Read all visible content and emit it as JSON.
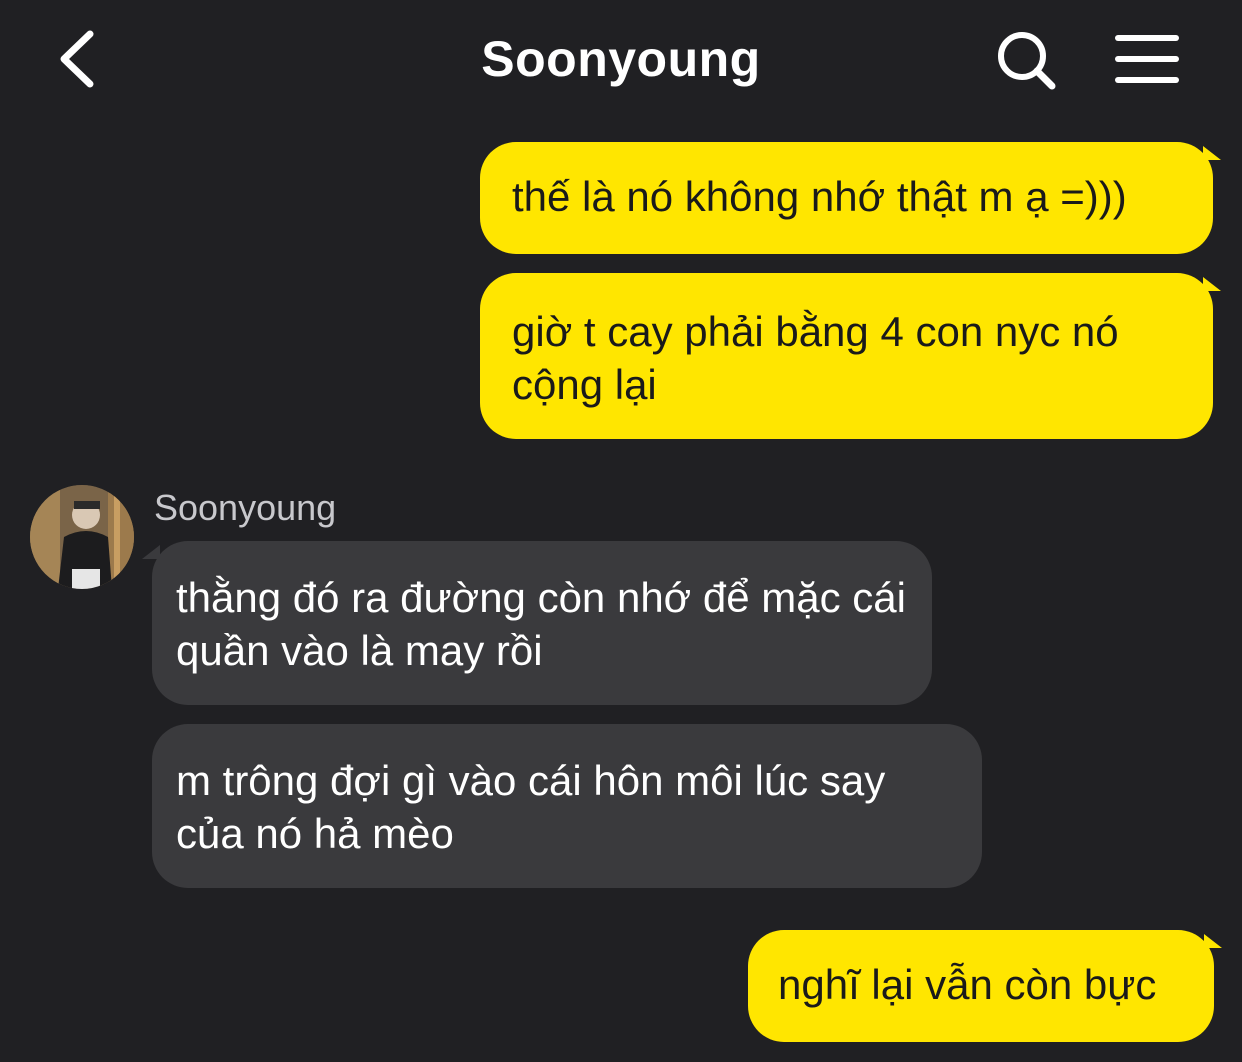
{
  "header": {
    "title": "Soonyoung",
    "back_icon": "chevron-left-icon",
    "search_icon": "search-icon",
    "menu_icon": "hamburger-menu-icon"
  },
  "colors": {
    "background": "#202023",
    "outgoing_bubble": "#ffe600",
    "incoming_bubble": "#3a3a3d"
  },
  "messages": [
    {
      "direction": "outgoing",
      "text": "thế là nó không nhớ thật m ạ =)))"
    },
    {
      "direction": "outgoing",
      "text": "giờ t cay phải bằng 4 con nyc nó cộng lại"
    },
    {
      "direction": "incoming",
      "sender": "Soonyoung",
      "text": "thằng đó ra đường còn nhớ để mặc cái quần vào là may rồi"
    },
    {
      "direction": "incoming",
      "text": "m trông đợi gì vào cái hôn môi lúc say của nó hả mèo"
    },
    {
      "direction": "outgoing",
      "text": "nghĩ lại vẫn còn bực"
    }
  ]
}
